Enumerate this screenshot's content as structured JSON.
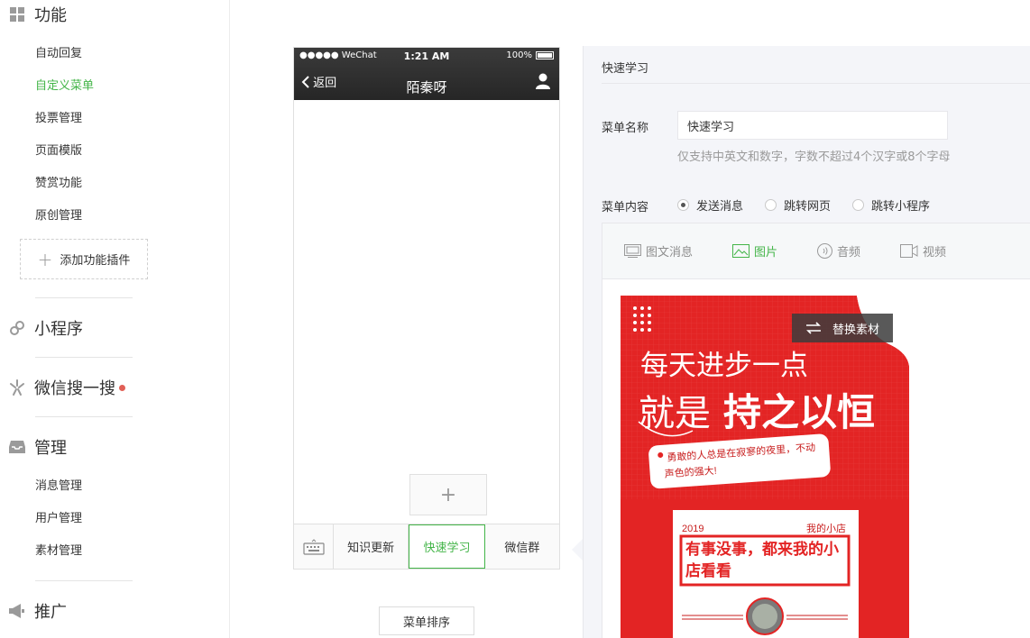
{
  "sidebar": {
    "sections": [
      {
        "title": "功能",
        "icon": "grid-icon",
        "items": [
          "自动回复",
          "自定义菜单",
          "投票管理",
          "页面模版",
          "赞赏功能",
          "原创管理"
        ],
        "active_item": "自定义菜单"
      },
      {
        "title": "小程序",
        "icon": "link-icon"
      },
      {
        "title": "微信搜一搜",
        "icon": "sparkle-icon",
        "has_badge": true
      },
      {
        "title": "管理",
        "icon": "inbox-icon",
        "items": [
          "消息管理",
          "用户管理",
          "素材管理"
        ]
      },
      {
        "title": "推广",
        "icon": "megaphone-icon"
      }
    ],
    "add_plugin_label": "添加功能插件"
  },
  "phone": {
    "status_left": "●●●●● WeChat",
    "status_time": "1:21 AM",
    "status_battery": "100%",
    "back_label": "返回",
    "title": "陌秦呀",
    "add_symbol": "+",
    "menu_items": [
      "知识更新",
      "快速学习",
      "微信群"
    ],
    "active_menu": "快速学习"
  },
  "sort_button": "菜单排序",
  "editor": {
    "title": "快速学习",
    "name_label": "菜单名称",
    "name_value": "快速学习",
    "name_hint": "仅支持中英文和数字，字数不超过4个汉字或8个字母",
    "content_label": "菜单内容",
    "content_options": [
      "发送消息",
      "跳转网页",
      "跳转小程序"
    ],
    "selected_option": "发送消息",
    "tabs": [
      "图文消息",
      "图片",
      "音频",
      "视频"
    ],
    "active_tab": "图片",
    "replace_label": "替换素材"
  },
  "poster": {
    "line1": "每天进步一点",
    "line2_a": "就是",
    "line2_b": "持之以恒",
    "tag_line1": "勇敢的人总是在寂寥的夜里，不动",
    "tag_line2": "声色的强大!",
    "card_year": "2019",
    "card_shop": "我的小店",
    "card_text1": "有事没事，都来我的小",
    "card_text2": "店看看",
    "colors": {
      "red": "#e32424",
      "dark_red": "#c81d1d"
    }
  },
  "colors": {
    "accent_green": "#44b549",
    "badge_red": "#e15f56"
  }
}
